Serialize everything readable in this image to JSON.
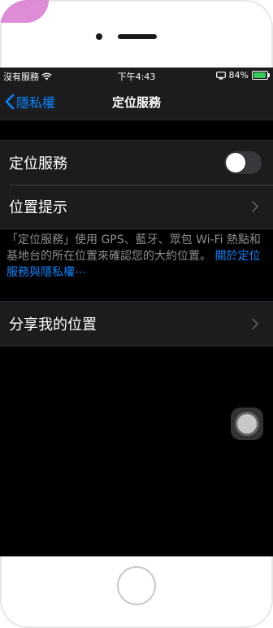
{
  "status_bar": {
    "carrier": "沒有服務",
    "time": "下午4:43",
    "battery": "84%",
    "battery_level": 0.84
  },
  "nav": {
    "back_label": "隱私權",
    "title": "定位服務"
  },
  "settings": {
    "location_services_label": "定位服務",
    "location_services_on": false,
    "location_alerts_label": "位置提示",
    "share_location_label": "分享我的位置"
  },
  "footer": {
    "text": "「定位服務」使用 GPS、藍牙、眾包 Wi-Fi 熱點和基地台的所在位置來確認您的大約位置。 ",
    "link": "關於定位服務與隱私權⋯"
  },
  "colors": {
    "accent": "#0a84ff",
    "background": "#000000",
    "cell": "#1c1c1e",
    "battery": "#34c759"
  },
  "icons": [
    "wifi-icon",
    "screen-mirroring-icon",
    "battery-icon",
    "chevron-left-icon",
    "chevron-right-icon",
    "assistive-touch-icon"
  ]
}
